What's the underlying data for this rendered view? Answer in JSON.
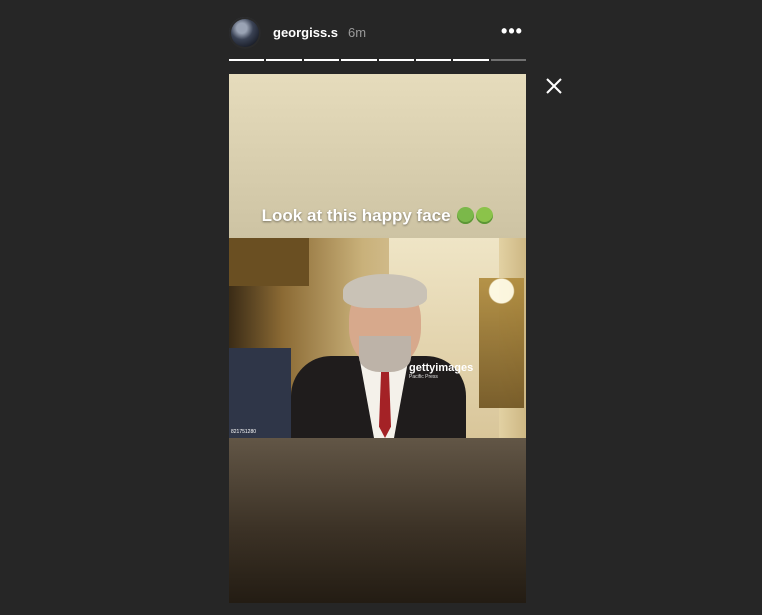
{
  "header": {
    "username": "georgiss.s",
    "time": "6m",
    "more_label": "•••"
  },
  "progress": {
    "total": 8,
    "completed": 7
  },
  "story": {
    "caption": "Look at this happy face",
    "emoji_icons": [
      "nauseated-face-icon",
      "vomiting-face-icon"
    ],
    "watermark": "gettyimages",
    "watermark_sub": "Pacific Press",
    "image_id": "821751280"
  },
  "colors": {
    "background": "#262626",
    "progress_done": "#ffffff",
    "progress_pending": "#8a8a8a",
    "text": "#ffffff",
    "muted": "#9a9a9a"
  }
}
